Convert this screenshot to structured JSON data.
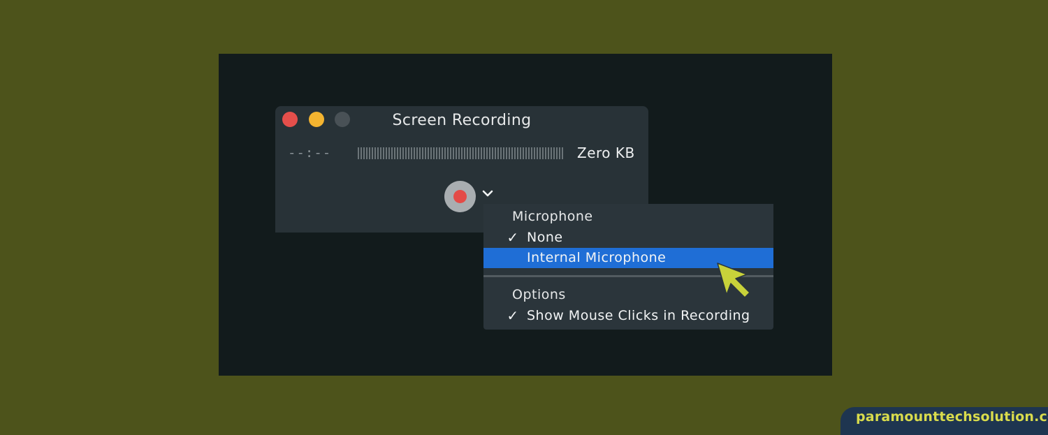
{
  "window": {
    "title": "Screen Recording",
    "timer": "--:--",
    "size_readout": "Zero KB"
  },
  "icons": {
    "close": "close-window-icon",
    "minimize": "minimize-window-icon",
    "maximize": "maximize-window-icon",
    "record": "record-icon",
    "options": "chevron-down-icon",
    "cursor": "mouse-pointer-icon",
    "check": "checkmark-icon"
  },
  "menu": {
    "microphone_header": "Microphone",
    "items": [
      {
        "label": "None",
        "checked": true,
        "check_mark": "✓"
      },
      {
        "label": "Internal Microphone",
        "checked": false,
        "check_mark": ""
      }
    ],
    "options_header": "Options",
    "option_items": [
      {
        "label": "Show Mouse Clicks in Recording",
        "checked": true,
        "check_mark": "✓"
      }
    ]
  },
  "watermark": "paramounttechsolution.com",
  "colors": {
    "background": "#4d531b",
    "panel": "#121b1c",
    "window": "#283237",
    "highlight": "#1f6ed6",
    "record": "#e44b47",
    "cursor": "#c8d23a",
    "watermark_text": "#d9dc4c"
  }
}
